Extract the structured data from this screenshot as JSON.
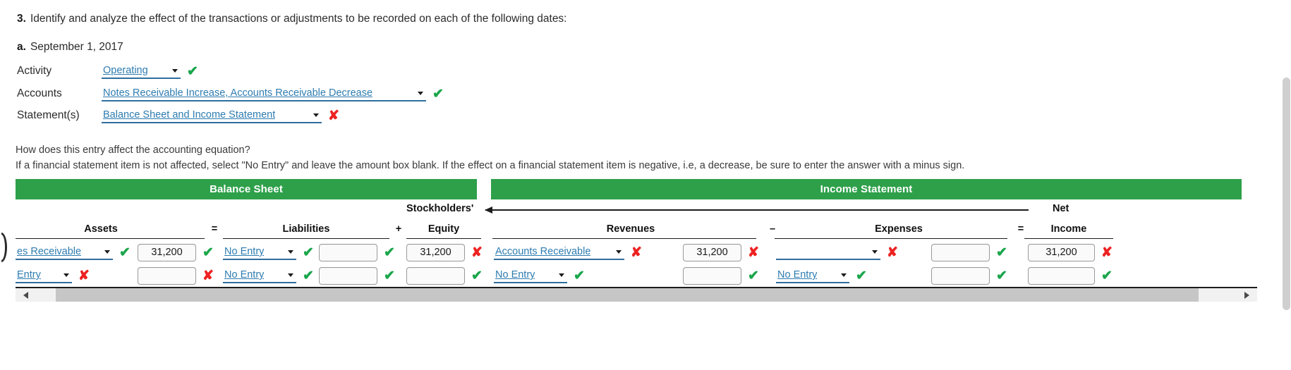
{
  "question": {
    "number": "3.",
    "text": "Identify and analyze the effect of the transactions or adjustments to be recorded on each of the following dates:",
    "sub_number": "a.",
    "sub_text": "September 1, 2017"
  },
  "fields": [
    {
      "label": "Activity",
      "value": "Operating",
      "status": "correct"
    },
    {
      "label": "Accounts",
      "value": "Notes Receivable Increase, Accounts Receivable Decrease",
      "status": "correct"
    },
    {
      "label": "Statement(s)",
      "value": "Balance Sheet and Income Statement",
      "status": "incorrect"
    }
  ],
  "instructions": {
    "line1": "How does this entry affect the accounting equation?",
    "line2": "If a financial statement item is not affected, select \"No Entry\" and leave the amount box blank. If the effect on a financial statement item is negative, i.e, a decrease, be sure to enter the answer with a minus sign."
  },
  "statement_headers": {
    "balance_sheet": "Balance Sheet",
    "income_statement": "Income Statement"
  },
  "band_labels": {
    "stockholders": "Stockholders'",
    "net": "Net"
  },
  "columns": {
    "assets": "Assets",
    "eq1": "=",
    "liabilities": "Liabilities",
    "plus": "+",
    "equity": "Equity",
    "revenues": "Revenues",
    "minus": "–",
    "expenses": "Expenses",
    "eq2": "=",
    "income": "Income"
  },
  "marks": {
    "correct": "✔",
    "incorrect": "✘"
  },
  "grid": {
    "rows": [
      {
        "assets_account": {
          "value": "es Receivable",
          "status": "correct"
        },
        "assets_amount": {
          "value": "31,200",
          "status": "correct"
        },
        "liabilities_account": {
          "value": "No Entry",
          "status": "correct"
        },
        "liabilities_amount": {
          "value": "",
          "status": "correct"
        },
        "equity_amount": {
          "value": "31,200",
          "status": "incorrect"
        },
        "revenues_account": {
          "value": "Accounts Receivable",
          "status": "incorrect"
        },
        "revenues_amount": {
          "value": "31,200",
          "status": "incorrect"
        },
        "expenses_account": {
          "value": "",
          "status": "incorrect"
        },
        "expenses_amount": {
          "value": "",
          "status": "correct"
        },
        "income_amount": {
          "value": "31,200",
          "status": "incorrect"
        }
      },
      {
        "assets_account": {
          "value": "Entry",
          "status": "incorrect"
        },
        "assets_amount": {
          "value": "",
          "status": "incorrect"
        },
        "liabilities_account": {
          "value": "No Entry",
          "status": "correct"
        },
        "liabilities_amount": {
          "value": "",
          "status": "correct"
        },
        "equity_amount": {
          "value": "",
          "status": "correct"
        },
        "revenues_account": {
          "value": "No Entry",
          "status": "correct"
        },
        "revenues_amount": {
          "value": "",
          "status": "correct"
        },
        "expenses_account": {
          "value": "No Entry",
          "status": "correct"
        },
        "expenses_amount": {
          "value": "",
          "status": "correct"
        },
        "income_amount": {
          "value": "",
          "status": "correct"
        }
      }
    ]
  },
  "colors": {
    "header_green": "#2ea04a",
    "correct_green": "#1aa64b",
    "incorrect_red": "#ee2222",
    "link_blue": "#2e7cb0"
  }
}
